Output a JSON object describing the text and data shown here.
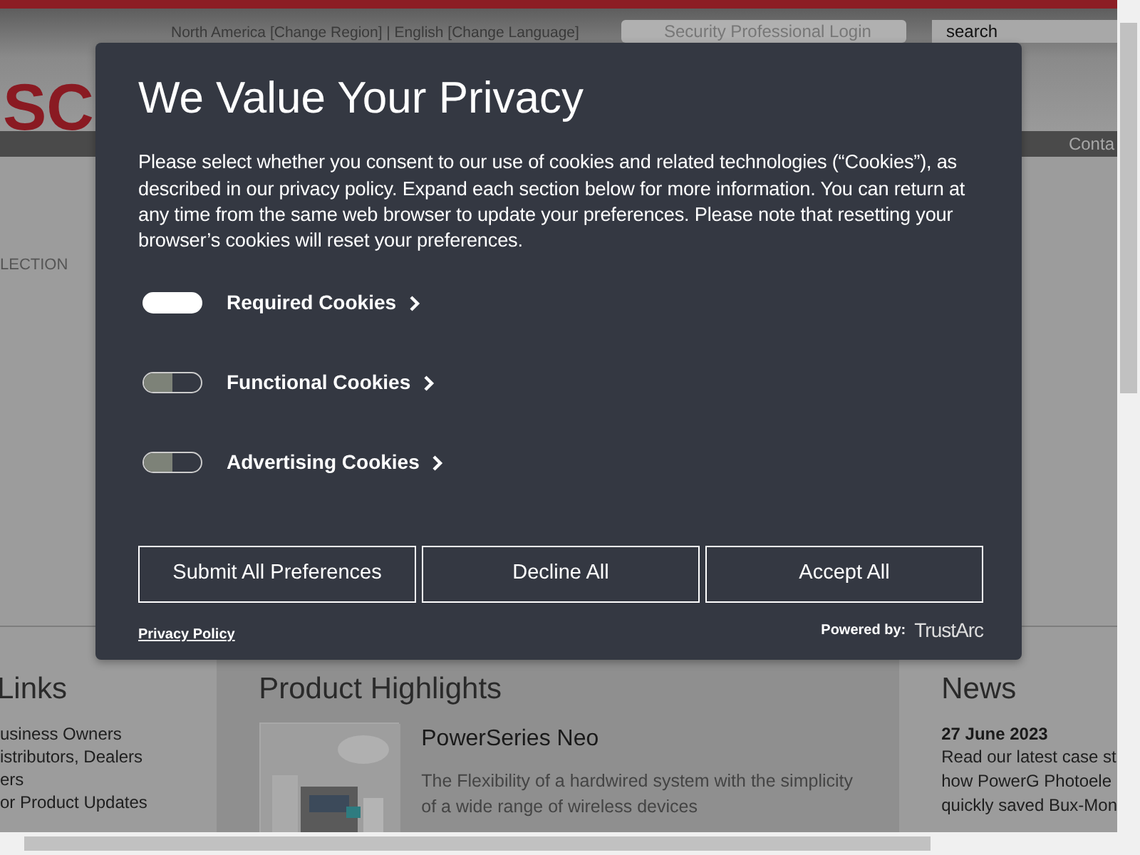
{
  "page": {
    "top_bar": {
      "region_text": "North America [Change Region]  |  English [Change Language]",
      "login_button": "Security Professional Login",
      "search": {
        "value": "search"
      }
    },
    "logo": "SC",
    "nav_items": [
      "Conta"
    ],
    "side_label": "LECTION",
    "links": {
      "title": "Links",
      "items": [
        "usiness Owners",
        "istributors, Dealers",
        "ers",
        "or Product Updates"
      ]
    },
    "highlights": {
      "title": "Product Highlights",
      "product": {
        "name": "PowerSeries Neo",
        "description": "The Flexibility of a hardwired system with the simplicity of a wide range of wireless devices"
      }
    },
    "news": {
      "title": "News",
      "date": "27 June 2023",
      "lines": [
        "Read our latest case st",
        "how PowerG Photoele",
        "quickly saved Bux-Mon"
      ]
    }
  },
  "privacy_dialog": {
    "title": "We Value Your Privacy",
    "description": "Please select whether you consent to our use of cookies and related technologies (“Cookies”), as described in our privacy policy. Expand each section below for more information. You can return at any time from the same web browser to update your preferences. Please note that resetting your browser’s cookies will reset your preferences.",
    "categories": [
      {
        "label": "Required Cookies",
        "on": true
      },
      {
        "label": "Functional Cookies",
        "on": false
      },
      {
        "label": "Advertising Cookies",
        "on": false
      }
    ],
    "buttons": [
      "Submit All Preferences",
      "Decline All",
      "Accept All"
    ],
    "privacy_link": "Privacy Policy",
    "powered_by": "Powered by:",
    "brand": "TrustArc"
  }
}
